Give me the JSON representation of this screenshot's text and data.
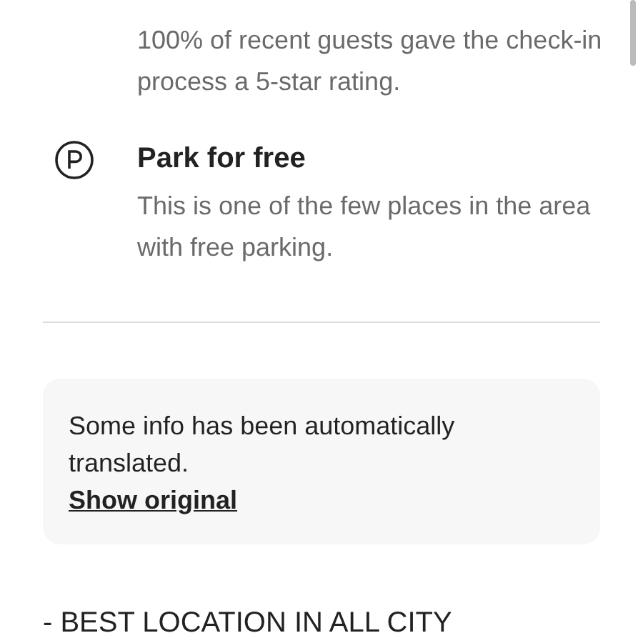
{
  "highlights": [
    {
      "kind": "checkin",
      "description": "100% of recent guests gave the check-in process a 5-star rating."
    },
    {
      "kind": "parking",
      "title": "Park for free",
      "description": "This is one of the few places in the area with free parking."
    }
  ],
  "translation_notice": {
    "message": "Some info has been automatically translated.",
    "link": "Show original"
  },
  "description": "- BEST LOCATION IN ALL CITY"
}
